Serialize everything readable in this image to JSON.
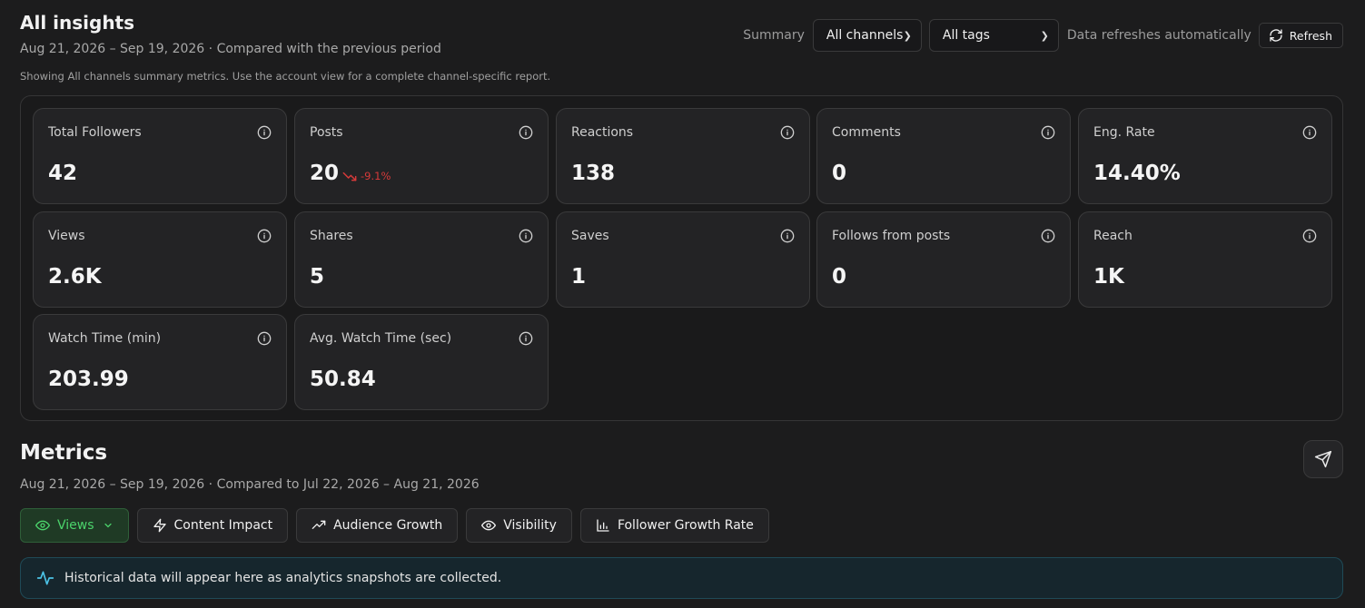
{
  "header": {
    "title": "All insights",
    "subtitle": "Aug 21, 2026 – Sep 19, 2026 · Compared with the previous period",
    "note": "Showing All channels summary metrics. Use the account view for a complete channel-specific report."
  },
  "controls": {
    "summary_label": "Summary",
    "channel_select": "All channels",
    "tag_select": "All tags",
    "refresh_note": "Data refreshes automatically",
    "refresh_label": "Refresh"
  },
  "cards": [
    {
      "label": "Total Followers",
      "value": "42"
    },
    {
      "label": "Posts",
      "value": "20",
      "delta": "-9.1%"
    },
    {
      "label": "Reactions",
      "value": "138"
    },
    {
      "label": "Comments",
      "value": "0"
    },
    {
      "label": "Eng. Rate",
      "value": "14.40%"
    },
    {
      "label": "Views",
      "value": "2.6K"
    },
    {
      "label": "Shares",
      "value": "5"
    },
    {
      "label": "Saves",
      "value": "1"
    },
    {
      "label": "Follows from posts",
      "value": "0"
    },
    {
      "label": "Reach",
      "value": "1K"
    },
    {
      "label": "Watch Time (min)",
      "value": "203.99"
    },
    {
      "label": "Avg. Watch Time (sec)",
      "value": "50.84"
    }
  ],
  "metrics": {
    "title": "Metrics",
    "subtitle": "Aug 21, 2026 – Sep 19, 2026 · Compared to Jul 22, 2026 – Aug 21, 2026",
    "tabs": [
      {
        "label": "Views",
        "icon": "eye-icon",
        "active": true
      },
      {
        "label": "Content Impact",
        "icon": "lightning-icon"
      },
      {
        "label": "Audience Growth",
        "icon": "trending-up-icon"
      },
      {
        "label": "Visibility",
        "icon": "eye-icon"
      },
      {
        "label": "Follower Growth Rate",
        "icon": "bar-chart-icon"
      }
    ]
  },
  "banner": {
    "text": "Historical data will appear here as analytics snapshots are collected."
  },
  "colors": {
    "accent_green": "#4bd36b",
    "negative_red": "#d63a3a",
    "banner_border": "#1f4a57"
  }
}
